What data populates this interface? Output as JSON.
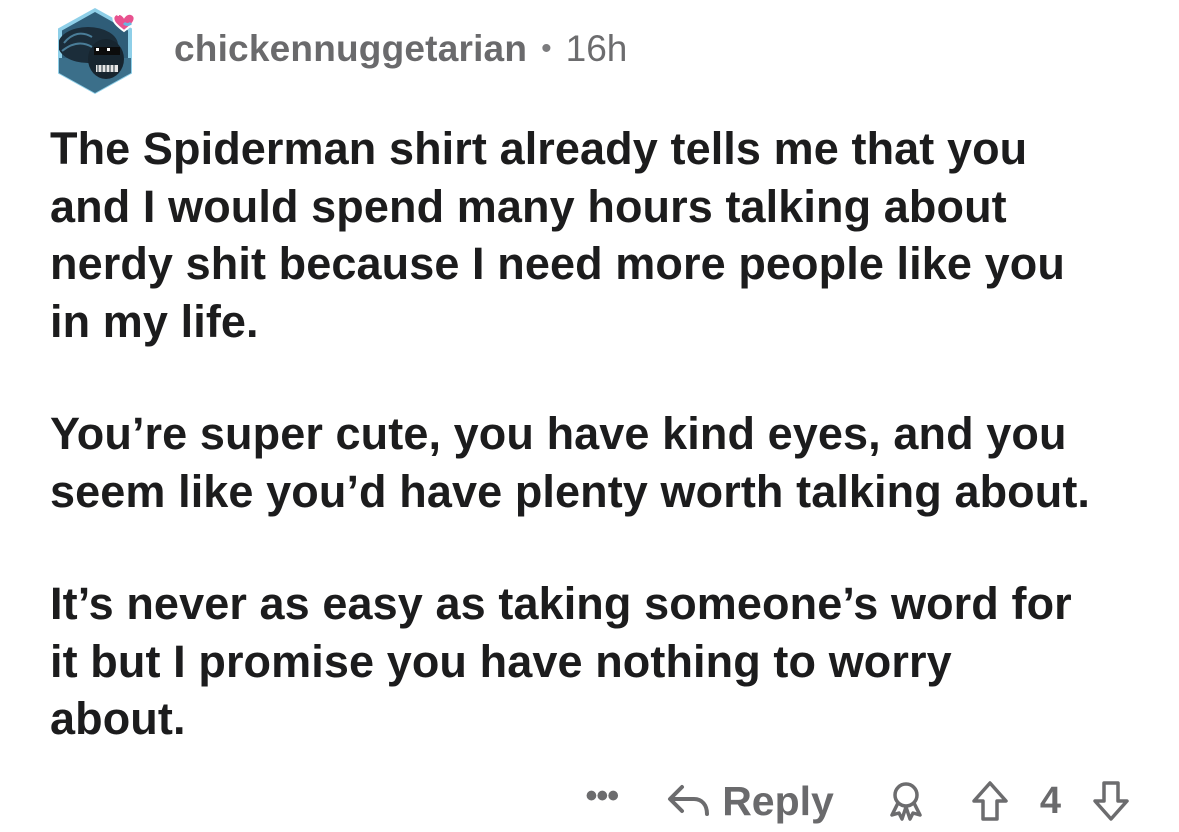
{
  "comment": {
    "author": {
      "username": "chickennuggetarian",
      "separator": "•",
      "timestamp": "16h"
    },
    "paragraphs": [
      "The Spiderman shirt already tells me that you\nand I would spend many hours talking about\nnerdy shit because I need more people like you\nin my life.",
      "You’re super cute, you have kind eyes, and you\nseem like you’d have plenty worth talking about.",
      "It’s never as easy as taking someone’s word for\nit but I promise you have nothing to worry\nabout."
    ],
    "actions": {
      "more_label": "•••",
      "reply_label": "Reply",
      "score": "4"
    }
  },
  "colors": {
    "meta_text": "#6c6c6e",
    "body_text": "#1c1c1d",
    "avatar_bg": "#2f5d78",
    "avatar_border": "#7fc6e5",
    "avatar_heart": "#e8528f"
  },
  "icons": {
    "avatar": "alien-avatar-icon",
    "more": "more-options-icon",
    "reply": "reply-arrow-icon",
    "award": "award-icon",
    "upvote": "upvote-arrow-icon",
    "downvote": "downvote-arrow-icon"
  }
}
